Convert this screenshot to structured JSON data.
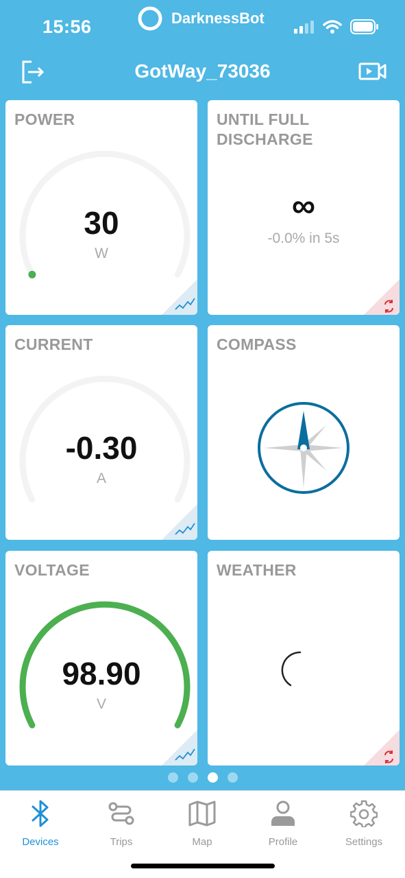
{
  "status_bar": {
    "time": "15:56",
    "app_name": "DarknessBot",
    "icons": [
      "signal-icon",
      "wifi-icon",
      "battery-icon"
    ]
  },
  "header": {
    "title": "GotWay_73036",
    "left_icon": "logout-icon",
    "right_icon": "video-camera-icon"
  },
  "cards": {
    "power": {
      "title": "POWER",
      "value": "30",
      "unit": "W",
      "level": 0.0
    },
    "discharge": {
      "title": "UNTIL FULL DISCHARGE",
      "value": "∞",
      "subtitle": "-0.0% in 5s"
    },
    "current": {
      "title": "CURRENT",
      "value": "-0.30",
      "unit": "A",
      "level": 0.0
    },
    "compass": {
      "title": "COMPASS"
    },
    "voltage": {
      "title": "VOLTAGE",
      "value": "98.90",
      "unit": "V",
      "level": 1.0
    },
    "weather": {
      "title": "WEATHER"
    }
  },
  "page_dots": {
    "count": 4,
    "active_index": 2
  },
  "tabs": [
    {
      "label": "Devices",
      "icon": "bluetooth-icon",
      "active": true
    },
    {
      "label": "Trips",
      "icon": "route-icon",
      "active": false
    },
    {
      "label": "Map",
      "icon": "map-icon",
      "active": false
    },
    {
      "label": "Profile",
      "icon": "person-icon",
      "active": false
    },
    {
      "label": "Settings",
      "icon": "gear-icon",
      "active": false
    }
  ],
  "colors": {
    "background": "#4fb8e4",
    "accent": "#1e90d6",
    "gauge_green": "#4caf50",
    "compass_blue": "#0b6e9e",
    "refresh_red": "#d9303a"
  }
}
